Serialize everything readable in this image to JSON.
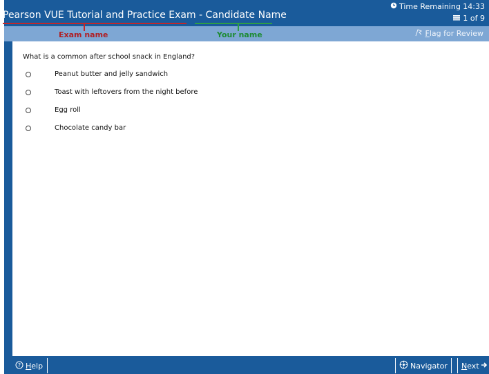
{
  "header": {
    "title": "Pearson VUE Tutorial and Practice Exam - Candidate Name",
    "timer_label": "Time Remaining 14:33",
    "counter": "1 of 9"
  },
  "annotations": {
    "exam_name": "Exam name",
    "your_name": "Your name"
  },
  "toolbar": {
    "flag_label": "Flag for Review"
  },
  "question": {
    "text": "What is a common after school snack in England?",
    "options": [
      "Peanut butter and jelly sandwich",
      "Toast with leftovers from the night before",
      "Egg roll",
      "Chocolate candy bar"
    ]
  },
  "footer": {
    "help_label": "Help",
    "navigator_label": "Navigator",
    "next_label": "Next"
  },
  "colors": {
    "header_blue": "#1a5b9b",
    "subbar_blue": "#7ea7d4",
    "annotation_red": "#b01f24",
    "annotation_green": "#1e8b34"
  }
}
